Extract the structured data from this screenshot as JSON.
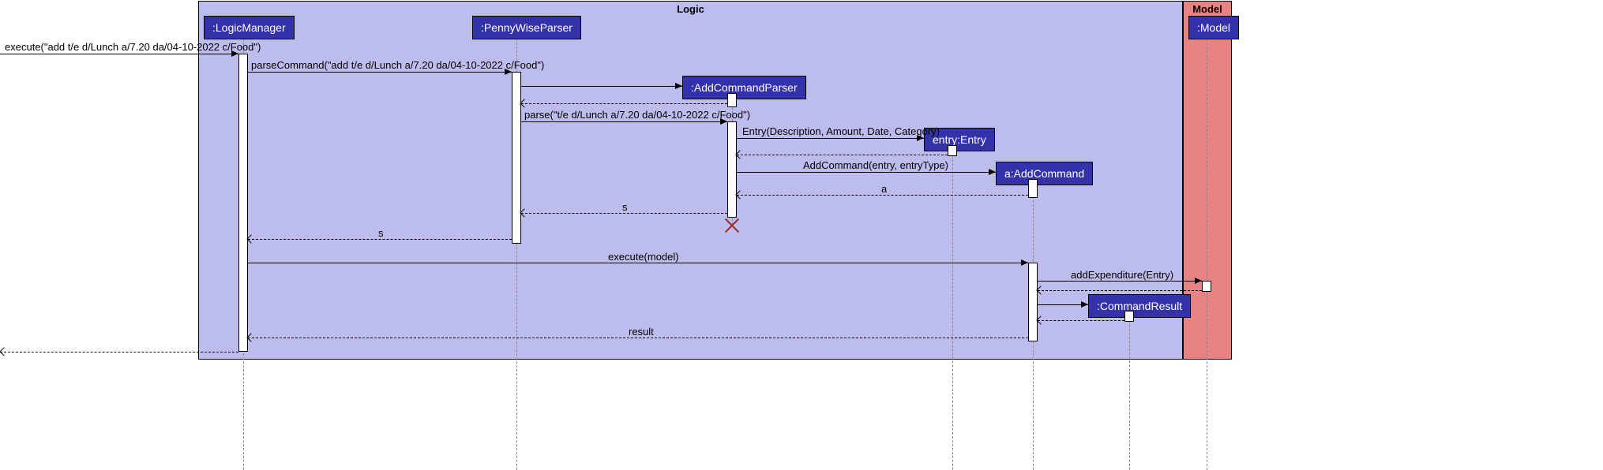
{
  "regions": {
    "logic": "Logic",
    "model": "Model"
  },
  "participants": {
    "logicManager": ":LogicManager",
    "pennyWiseParser": ":PennyWiseParser",
    "addCommandParser": ":AddCommandParser",
    "entry": "entry:Entry",
    "addCommand": "a:AddCommand",
    "commandResult": ":CommandResult",
    "modelBox": ":Model"
  },
  "messages": {
    "m1": "execute(\"add t/e d/Lunch a/7.20 da/04-10-2022 c/Food\")",
    "m2": "parseCommand(\"add t/e d/Lunch a/7.20 da/04-10-2022 c/Food\")",
    "m3": "parse(\"t/e d/Lunch a/7.20 da/04-10-2022 c/Food\")",
    "m4": "Entry(Description, Amount, Date, Category)",
    "m5": "AddCommand(entry, entryType)",
    "r_a": "a",
    "r_s1": "s",
    "r_s2": "s",
    "m6": "execute(model)",
    "m7": "addExpenditure(Entry)",
    "r_result": "result"
  },
  "chart_data": {
    "type": "other",
    "diagram": "UML sequence diagram",
    "frames": [
      {
        "name": "Logic",
        "participants": [
          ":LogicManager",
          ":PennyWiseParser",
          ":AddCommandParser",
          "entry:Entry",
          "a:AddCommand",
          ":CommandResult"
        ]
      },
      {
        "name": "Model",
        "participants": [
          ":Model"
        ]
      }
    ],
    "participants": [
      ":LogicManager",
      ":PennyWiseParser",
      ":AddCommandParser",
      "entry:Entry",
      "a:AddCommand",
      ":CommandResult",
      ":Model"
    ],
    "messages": [
      {
        "from": "(caller)",
        "to": ":LogicManager",
        "label": "execute(\"add t/e d/Lunch a/7.20 da/04-10-2022 c/Food\")",
        "type": "call"
      },
      {
        "from": ":LogicManager",
        "to": ":PennyWiseParser",
        "label": "parseCommand(\"add t/e d/Lunch a/7.20 da/04-10-2022 c/Food\")",
        "type": "call"
      },
      {
        "from": ":PennyWiseParser",
        "to": ":AddCommandParser",
        "label": "",
        "type": "create"
      },
      {
        "from": ":AddCommandParser",
        "to": ":PennyWiseParser",
        "label": "",
        "type": "return"
      },
      {
        "from": ":PennyWiseParser",
        "to": ":AddCommandParser",
        "label": "parse(\"t/e d/Lunch a/7.20 da/04-10-2022 c/Food\")",
        "type": "call"
      },
      {
        "from": ":AddCommandParser",
        "to": "entry:Entry",
        "label": "Entry(Description, Amount, Date, Category)",
        "type": "create"
      },
      {
        "from": "entry:Entry",
        "to": ":AddCommandParser",
        "label": "",
        "type": "return"
      },
      {
        "from": ":AddCommandParser",
        "to": "a:AddCommand",
        "label": "AddCommand(entry, entryType)",
        "type": "create"
      },
      {
        "from": "a:AddCommand",
        "to": ":AddCommandParser",
        "label": "a",
        "type": "return"
      },
      {
        "from": ":AddCommandParser",
        "to": ":PennyWiseParser",
        "label": "s",
        "type": "return"
      },
      {
        "from": ":AddCommandParser",
        "to": "",
        "label": "",
        "type": "destroy"
      },
      {
        "from": ":PennyWiseParser",
        "to": ":LogicManager",
        "label": "s",
        "type": "return"
      },
      {
        "from": ":LogicManager",
        "to": "a:AddCommand",
        "label": "execute(model)",
        "type": "call"
      },
      {
        "from": "a:AddCommand",
        "to": ":Model",
        "label": "addExpenditure(Entry)",
        "type": "call"
      },
      {
        "from": ":Model",
        "to": "a:AddCommand",
        "label": "",
        "type": "return"
      },
      {
        "from": "a:AddCommand",
        "to": ":CommandResult",
        "label": "",
        "type": "create"
      },
      {
        "from": ":CommandResult",
        "to": "a:AddCommand",
        "label": "",
        "type": "return"
      },
      {
        "from": "a:AddCommand",
        "to": ":LogicManager",
        "label": "result",
        "type": "return"
      },
      {
        "from": ":LogicManager",
        "to": "(caller)",
        "label": "",
        "type": "return"
      }
    ]
  }
}
